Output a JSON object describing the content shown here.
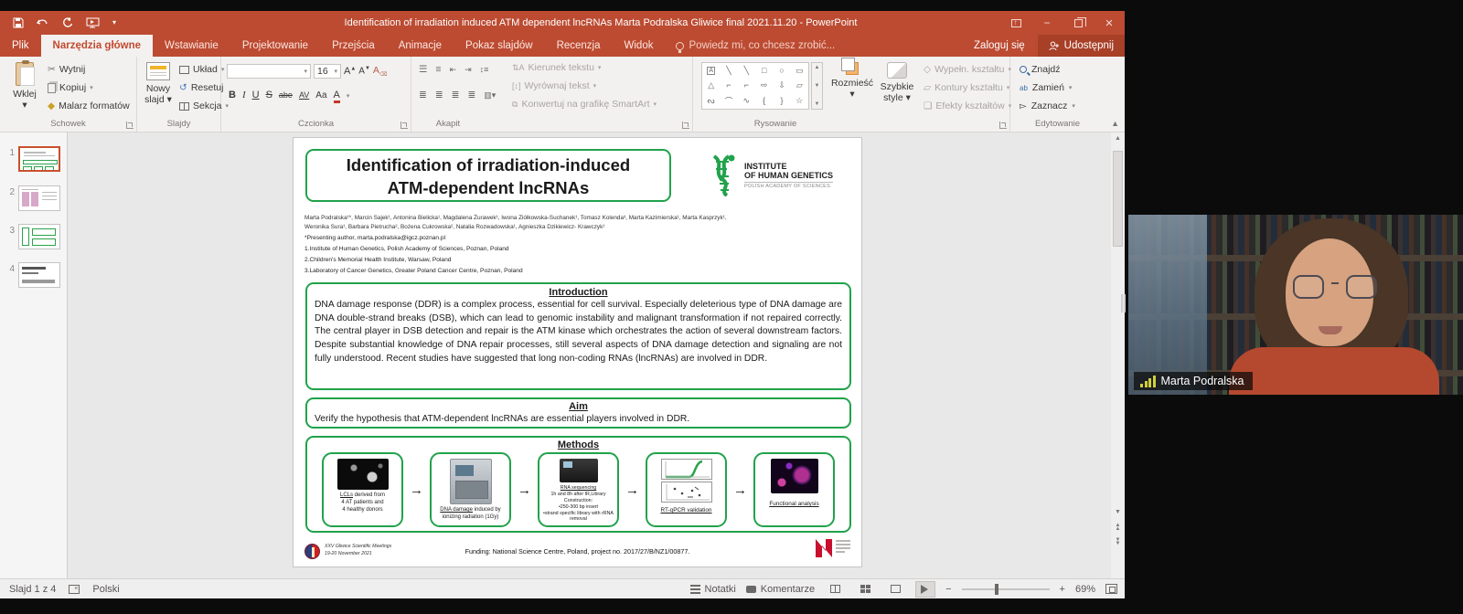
{
  "titlebar": {
    "title": "Identification of irradiation induced ATM dependent lncRNAs Marta Podralska Gliwice final 2021.11.20 - PowerPoint",
    "minimize_glyph": "−",
    "close_glyph": "×"
  },
  "tabs": {
    "file": "Plik",
    "items": [
      "Narzędzia główne",
      "Wstawianie",
      "Projektowanie",
      "Przejścia",
      "Animacje",
      "Pokaz slajdów",
      "Recenzja",
      "Widok"
    ],
    "tell_me": "Powiedz mi, co chcesz zrobić...",
    "sign_in": "Zaloguj się",
    "share": "Udostępnij"
  },
  "ribbon": {
    "paste": "Wklej",
    "cut": "Wytnij",
    "copy": "Kopiuj",
    "format_painter": "Malarz formatów",
    "clipboard_group": "Schowek",
    "new_slide": "Nowy slajd",
    "layout": "Układ",
    "reset": "Resetuj",
    "section": "Sekcja",
    "slides_group": "Slajdy",
    "font_name": "",
    "font_size": "16",
    "font_buttons": [
      "B",
      "I",
      "U",
      "S",
      "abe",
      "AV",
      "Aa",
      "A"
    ],
    "font_group": "Czcionka",
    "text_direction": "Kierunek tekstu",
    "align_text": "Wyrównaj tekst",
    "smartart": "Konwertuj na grafikę SmartArt",
    "paragraph_group": "Akapit",
    "arrange": "Rozmieść",
    "quick_styles": "Szybkie style",
    "shape_fill": "Wypełn. kształtu",
    "shape_outline": "Kontury kształtu",
    "shape_effects": "Efekty kształtów",
    "drawing_group": "Rysowanie",
    "find": "Znajdź",
    "replace": "Zamień",
    "select": "Zaznacz",
    "editing_group": "Edytowanie",
    "shape_glyphs": [
      "A",
      "╲",
      "╲",
      "□",
      "○",
      "▭",
      "△",
      "⌐",
      "⌐",
      "⇨",
      "⇩",
      "▱",
      "ᔓ",
      "⌒",
      "∿",
      "{",
      "}",
      "☆"
    ]
  },
  "slides_panel": {
    "slides": [
      {
        "number": "1"
      },
      {
        "number": "2"
      },
      {
        "number": "3"
      },
      {
        "number": "4"
      }
    ]
  },
  "slide": {
    "title": "Identification of irradiation-induced\nATM-dependent lncRNAs",
    "logo": {
      "line1": "INSTITUTE",
      "line2": "OF HUMAN GENETICS",
      "line3": "POLISH ACADEMY OF SCIENCES"
    },
    "authors_line1": "Marta Podralska¹*, Marcin Sajek¹, Antonina Bielicka¹, Magdalena Żurawek¹, Iwona Ziółkowska-Suchanek¹, Tomasz Kolenda³, Marta Kazimierska¹, Marta Kasprzyk¹,",
    "authors_line2": "Weronika Sura¹, Barbara Pietrucha², Bożena Cukrowska², Natalia Rozwadowska¹, Agnieszka Dzikiewicz- Krawczyk¹",
    "presenting": "*Presenting author, marta.podralska@igcz.poznan.pl",
    "affil1": "1.Institute of Human Genetics, Polish Academy of Sciences, Poznan, Poland",
    "affil2": "2.Children's Memorial Health Institute, Warsaw, Poland",
    "affil3": "3.Laboratory of Cancer Genetics, Greater Poland Cancer Centre, Poznan, Poland",
    "introduction": {
      "heading": "Introduction",
      "body": "DNA damage response (DDR) is a complex process, essential for cell survival. Especially deleterious type of DNA damage are DNA double-strand breaks (DSB), which can lead to genomic instability and malignant transformation if not repaired correctly. The central player in DSB detection and repair is the ATM kinase which orchestrates the action of several downstream factors. Despite substantial knowledge of DNA repair processes, still several aspects of DNA damage detection and signaling are not fully understood. Recent studies have suggested that long non-coding RNAs (lncRNAs) are involved in DDR."
    },
    "aim": {
      "heading": "Aim",
      "body": "Verify the hypothesis that ATM-dependent lncRNAs are essential players involved in DDR."
    },
    "methods": {
      "heading": "Methods",
      "arrow": "→",
      "steps": [
        {
          "u": "LCLs",
          "rest": " derived from\n4 AT patients and\n4 healthy donors"
        },
        {
          "u": "DNA damage",
          "rest": " induced by\nionizing radiation (1Gy)"
        },
        {
          "u": "RNA sequencing",
          "rest": "\n1h and 8h after IR,Library\nConstruction:\n•250-300 bp insert\n•strand specific library with rRNA\nremoval"
        },
        {
          "u": "RT-qPCR validation",
          "rest": ""
        },
        {
          "u": "Functional analysis",
          "rest": ""
        }
      ]
    },
    "footer": {
      "conference": "XXV Gliwice Scientific Meetings\n19-20 November 2021",
      "funding": "Funding: National Science Centre, Poland, project no. 2017/27/B/NZ1/00877."
    }
  },
  "status_bar": {
    "slide_counter": "Slajd 1 z 4",
    "language": "Polski",
    "notes": "Notatki",
    "comments": "Komentarze",
    "zoom_minus": "−",
    "zoom_plus": "+",
    "zoom_level": "69%"
  },
  "webcam": {
    "name": "Marta Podralska"
  }
}
